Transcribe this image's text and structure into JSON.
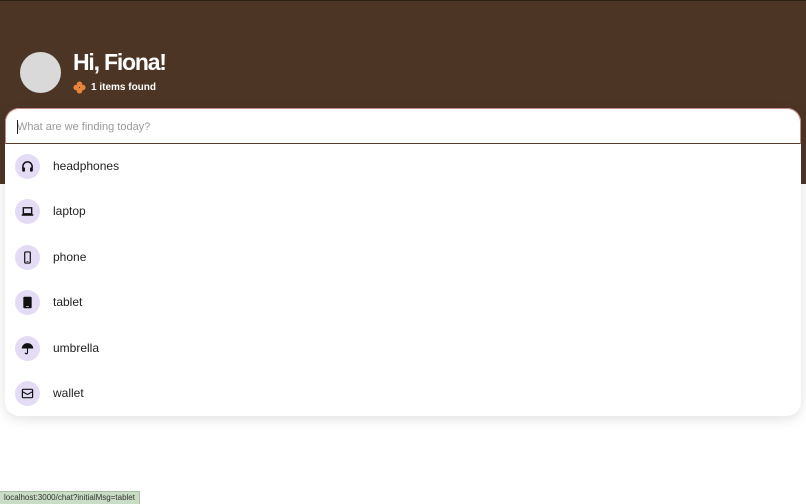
{
  "header": {
    "greeting": "Hi, Fiona!",
    "status_text": "1 items found",
    "background": "#4d3526",
    "status_icon": "clover-icon",
    "status_icon_color": "#e8853a"
  },
  "search": {
    "placeholder": "What are we finding today?",
    "value": ""
  },
  "suggestions": [
    {
      "label": "headphones",
      "icon": "headphones-icon"
    },
    {
      "label": "laptop",
      "icon": "laptop-icon"
    },
    {
      "label": "phone",
      "icon": "phone-icon"
    },
    {
      "label": "tablet",
      "icon": "tablet-icon"
    },
    {
      "label": "umbrella",
      "icon": "umbrella-icon"
    },
    {
      "label": "wallet",
      "icon": "wallet-icon"
    }
  ],
  "icon_bg_color": "#e4dcf5",
  "statusbar": {
    "url": "localhost:3000/chat?initialMsg=tablet"
  }
}
